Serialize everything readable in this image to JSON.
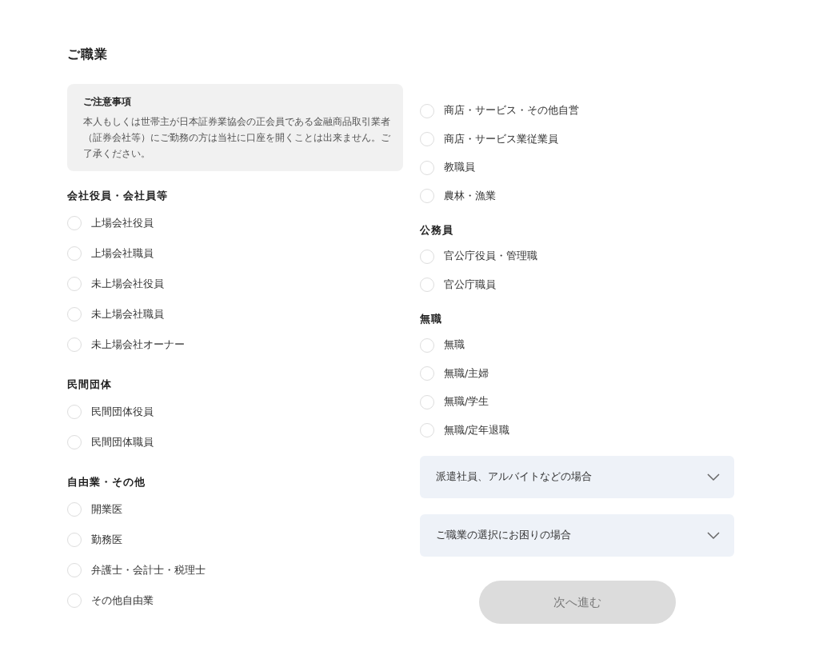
{
  "title": "ご職業",
  "left_column": {
    "notice": {
      "heading": "ご注意事項",
      "text": "本人もしくは世帯主が日本証券業協会の正会員である金融商品取引業者（証券会社等）にご勤務の方は当社に口座を開くことは出来ません。ご了承ください。"
    },
    "groups": [
      {
        "heading": "会社役員・会社員等",
        "options": [
          {
            "label": "上場会社役員",
            "selected": false
          },
          {
            "label": "上場会社職員",
            "selected": false
          },
          {
            "label": "未上場会社役員",
            "selected": false
          },
          {
            "label": "未上場会社職員",
            "selected": false
          },
          {
            "label": "未上場会社オーナー",
            "selected": false
          }
        ]
      },
      {
        "heading": "民間団体",
        "options": [
          {
            "label": "民間団体役員",
            "selected": false
          },
          {
            "label": "民間団体職員",
            "selected": false
          }
        ]
      },
      {
        "heading": "自由業・その他",
        "options": [
          {
            "label": "開業医",
            "selected": false
          },
          {
            "label": "勤務医",
            "selected": false
          },
          {
            "label": "弁護士・会計士・税理士",
            "selected": false
          },
          {
            "label": "その他自由業",
            "selected": false
          }
        ]
      }
    ]
  },
  "right_column": {
    "groups": [
      {
        "options": [
          {
            "label": "商店・サービス・その他自営",
            "selected": false
          },
          {
            "label": "商店・サービス業従業員",
            "selected": false
          },
          {
            "label": "教職員",
            "selected": false
          },
          {
            "label": "農林・漁業",
            "selected": false
          }
        ]
      },
      {
        "heading": "公務員",
        "options": [
          {
            "label": "官公庁役員・管理職",
            "selected": false
          },
          {
            "label": "官公庁職員",
            "selected": false
          }
        ]
      },
      {
        "heading": "無職",
        "options": [
          {
            "label": "無職",
            "selected": false
          },
          {
            "label": "無職/主婦",
            "selected": false
          },
          {
            "label": "無職/学生",
            "selected": false
          },
          {
            "label": "無職/定年退職",
            "selected": false
          }
        ]
      }
    ],
    "accordions": [
      {
        "label": "派遣社員、アルバイトなどの場合",
        "expanded": false
      },
      {
        "label": "ご職業の選択にお困りの場合",
        "expanded": false
      }
    ],
    "next_button": {
      "label": "次へ進む",
      "disabled": true
    }
  }
}
